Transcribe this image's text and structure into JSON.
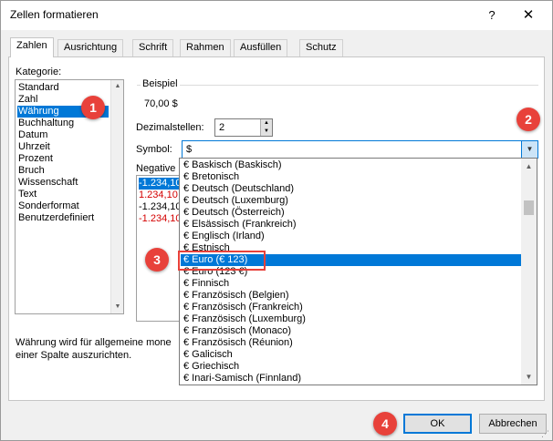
{
  "window": {
    "title": "Zellen formatieren",
    "help": "?",
    "close": "✕"
  },
  "tabs": [
    "Zahlen",
    "Ausrichtung",
    "Schrift",
    "Rahmen",
    "Ausfüllen",
    "Schutz"
  ],
  "category": {
    "label": "Kategorie:",
    "items": [
      "Standard",
      "Zahl",
      "Währung",
      "Buchhaltung",
      "Datum",
      "Uhrzeit",
      "Prozent",
      "Bruch",
      "Wissenschaft",
      "Text",
      "Sonderformat",
      "Benutzerdefiniert"
    ],
    "selected": "Währung"
  },
  "sample": {
    "label": "Beispiel",
    "value": "70,00 $"
  },
  "decimals": {
    "label": "Dezimalstellen:",
    "value": "2"
  },
  "symbol": {
    "label": "Symbol:",
    "value": "$",
    "options": [
      "€ Baskisch (Baskisch)",
      "€ Bretonisch",
      "€ Deutsch (Deutschland)",
      "€ Deutsch (Luxemburg)",
      "€ Deutsch (Österreich)",
      "€ Elsässisch (Frankreich)",
      "€ Englisch (Irland)",
      "€ Estnisch",
      "€ Euro (€ 123)",
      "€ Euro (123 €)",
      "€ Finnisch",
      "€ Französisch (Belgien)",
      "€ Französisch (Frankreich)",
      "€ Französisch (Luxemburg)",
      "€ Französisch (Monaco)",
      "€ Französisch (Réunion)",
      "€ Galicisch",
      "€ Griechisch",
      "€ Inari-Samisch (Finnland)"
    ],
    "highlighted": "€ Euro (€ 123)"
  },
  "negative": {
    "label": "Negative",
    "items": [
      {
        "text": "-1.234,10",
        "color": "#000000"
      },
      {
        "text": "1.234,10",
        "color": "#d40000"
      },
      {
        "text": "-1.234,10",
        "color": "#000000"
      },
      {
        "text": "-1.234,10",
        "color": "#d40000"
      }
    ]
  },
  "description": "Währung wird für allgemeine mone einer Spalte auszurichten.",
  "description_lines": [
    "Währung wird für allgemeine mone",
    "einer Spalte auszurichten."
  ],
  "buttons": {
    "ok": "OK",
    "cancel": "Abbrechen"
  },
  "badges": [
    "1",
    "2",
    "3",
    "4"
  ],
  "colors": {
    "accent": "#0078d7",
    "badge": "#e8413a",
    "negative_red": "#d40000"
  }
}
